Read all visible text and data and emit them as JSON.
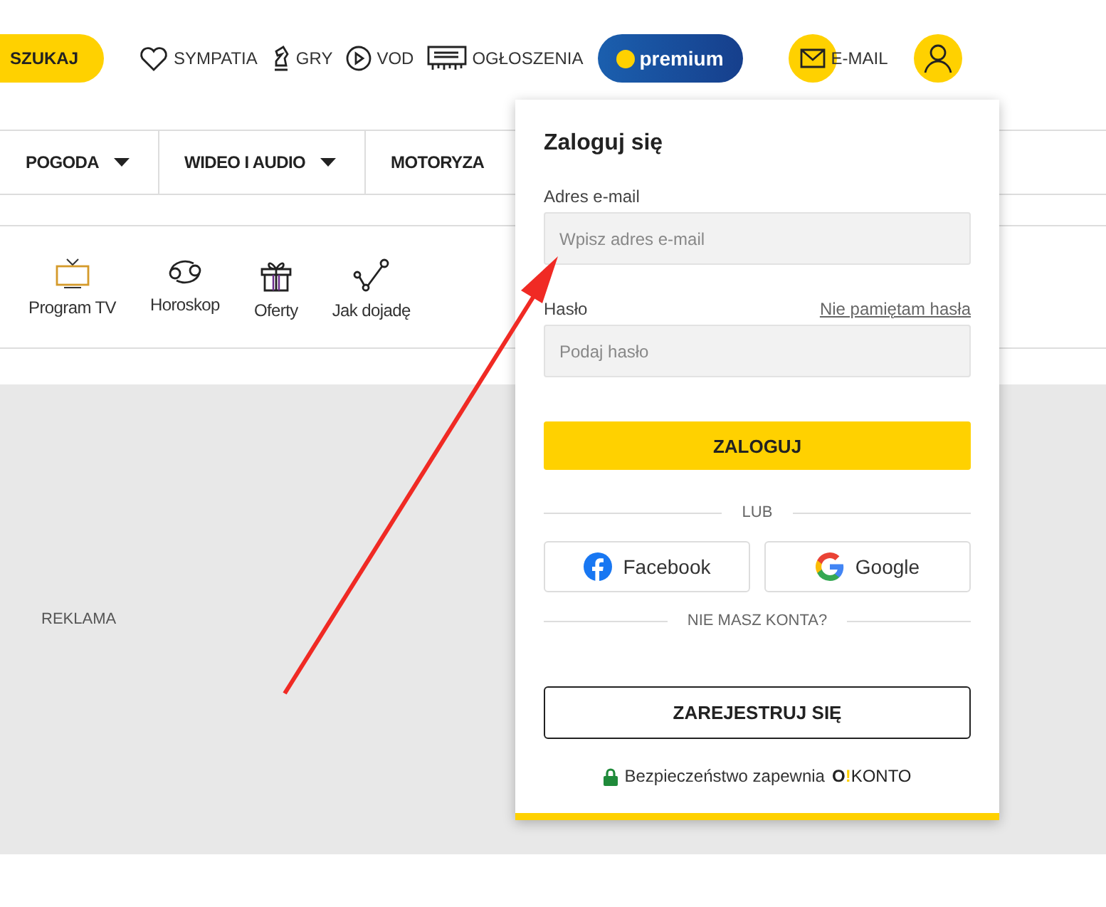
{
  "header": {
    "search_button": "SZUKAJ",
    "links": [
      {
        "label": "SYMPATIA"
      },
      {
        "label": "GRY"
      },
      {
        "label": "VOD"
      },
      {
        "label": "OGŁOSZENIA"
      }
    ],
    "premium": "premium",
    "email": "E-MAIL"
  },
  "categories": [
    {
      "label": "POGODA",
      "dropdown": true
    },
    {
      "label": "WIDEO I AUDIO",
      "dropdown": true
    },
    {
      "label": "MOTORYZA",
      "dropdown": false
    }
  ],
  "shortcuts": [
    {
      "label": "Program TV"
    },
    {
      "label": "Horoskop"
    },
    {
      "label": "Oferty"
    },
    {
      "label": "Jak dojadę"
    }
  ],
  "ad": {
    "label": "REKLAMA"
  },
  "login": {
    "title": "Zaloguj się",
    "email_label": "Adres e-mail",
    "email_placeholder": "Wpisz adres e-mail",
    "password_label": "Hasło",
    "forgot": "Nie pamiętam hasła",
    "password_placeholder": "Podaj hasło",
    "submit": "ZALOGUJ",
    "or": "LUB",
    "social": [
      {
        "kind": "facebook",
        "label": "Facebook"
      },
      {
        "kind": "google",
        "label": "Google"
      }
    ],
    "no_account": "NIE MASZ KONTA?",
    "register": "ZAREJESTRUJ SIĘ",
    "security": "Bezpieczeństwo zapewnia",
    "logo": {
      "mark": "O",
      "bang": "!",
      "word": "KONTO"
    }
  }
}
